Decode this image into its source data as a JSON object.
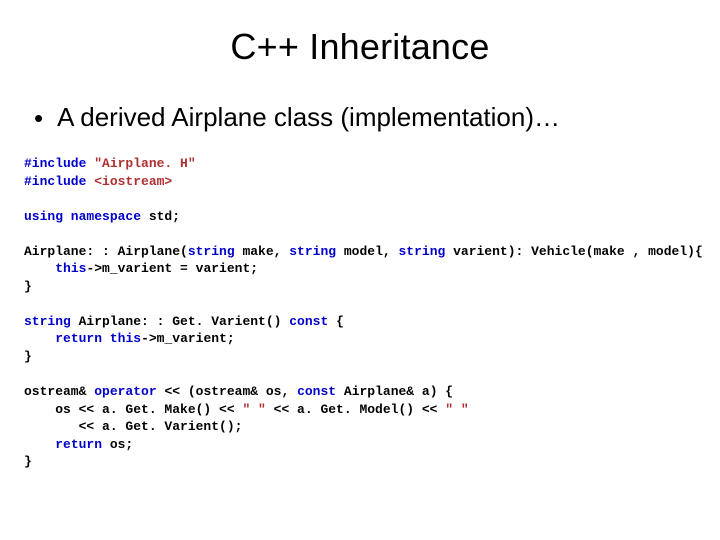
{
  "title": "C++ Inheritance",
  "bullet": "A derived Airplane class (implementation)…",
  "code": {
    "l01a": "#include",
    "l01b": " \"Airplane. H\"",
    "l02a": "#include",
    "l02b": " <iostream>",
    "l03": "",
    "l04a": "using namespace",
    "l04b": " std;",
    "l05": "",
    "l06a": "Airplane: : Airplane(",
    "l06b": "string",
    "l06c": " make, ",
    "l06d": "string",
    "l06e": " model, ",
    "l06f": "string",
    "l06g": " varient): Vehicle(make , model){",
    "l07a": "    ",
    "l07b": "this",
    "l07c": "->m_varient = varient;",
    "l08": "}",
    "l09": "",
    "l10a": "string",
    "l10b": " Airplane: : Get. Varient() ",
    "l10c": "const",
    "l10d": " {",
    "l11a": "    ",
    "l11b": "return",
    "l11c": " ",
    "l11d": "this",
    "l11e": "->m_varient;",
    "l12": "}",
    "l13": "",
    "l14a": "ostream& ",
    "l14b": "operator",
    "l14c": " << (ostream& os, ",
    "l14d": "const",
    "l14e": " Airplane& a) {",
    "l15a": "    os << a. Get. Make() << ",
    "l15b": "\" \"",
    "l15c": " << a. Get. Model() << ",
    "l15d": "\" \"",
    "l16": "       << a. Get. Varient();",
    "l17a": "    ",
    "l17b": "return",
    "l17c": " os;",
    "l18": "}"
  }
}
